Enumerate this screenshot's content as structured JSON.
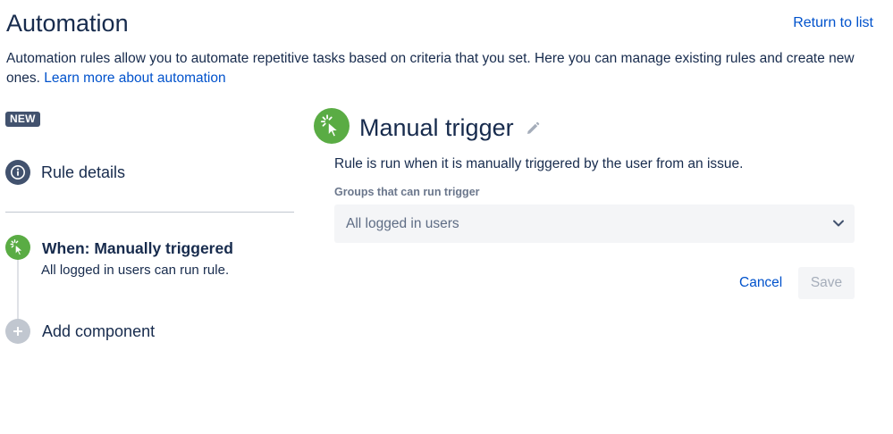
{
  "header": {
    "title": "Automation",
    "return_link": "Return to list"
  },
  "description": {
    "text": "Automation rules allow you to automate repetitive tasks based on criteria that you set. Here you can manage existing rules and create new ones. ",
    "link": "Learn more about automation"
  },
  "sidebar": {
    "badge": "NEW",
    "rule_details_label": "Rule details",
    "trigger": {
      "title": "When: Manually triggered",
      "subtitle": "All logged in users can run rule."
    },
    "add_component_label": "Add component"
  },
  "panel": {
    "title": "Manual trigger",
    "description": "Rule is run when it is manually triggered by the user from an issue.",
    "groups_field": {
      "label": "Groups that can run trigger",
      "selected_value": "All logged in users"
    },
    "buttons": {
      "cancel": "Cancel",
      "save": "Save"
    }
  },
  "colors": {
    "accent_green": "#5aac44",
    "link_blue": "#0052cc",
    "badge_bg": "#42526e",
    "text_dark": "#172b4d"
  },
  "icons": {
    "info": "info-icon",
    "trigger": "cursor-click-icon",
    "add": "plus-icon",
    "edit": "pencil-icon",
    "dropdown": "chevron-down-icon"
  }
}
